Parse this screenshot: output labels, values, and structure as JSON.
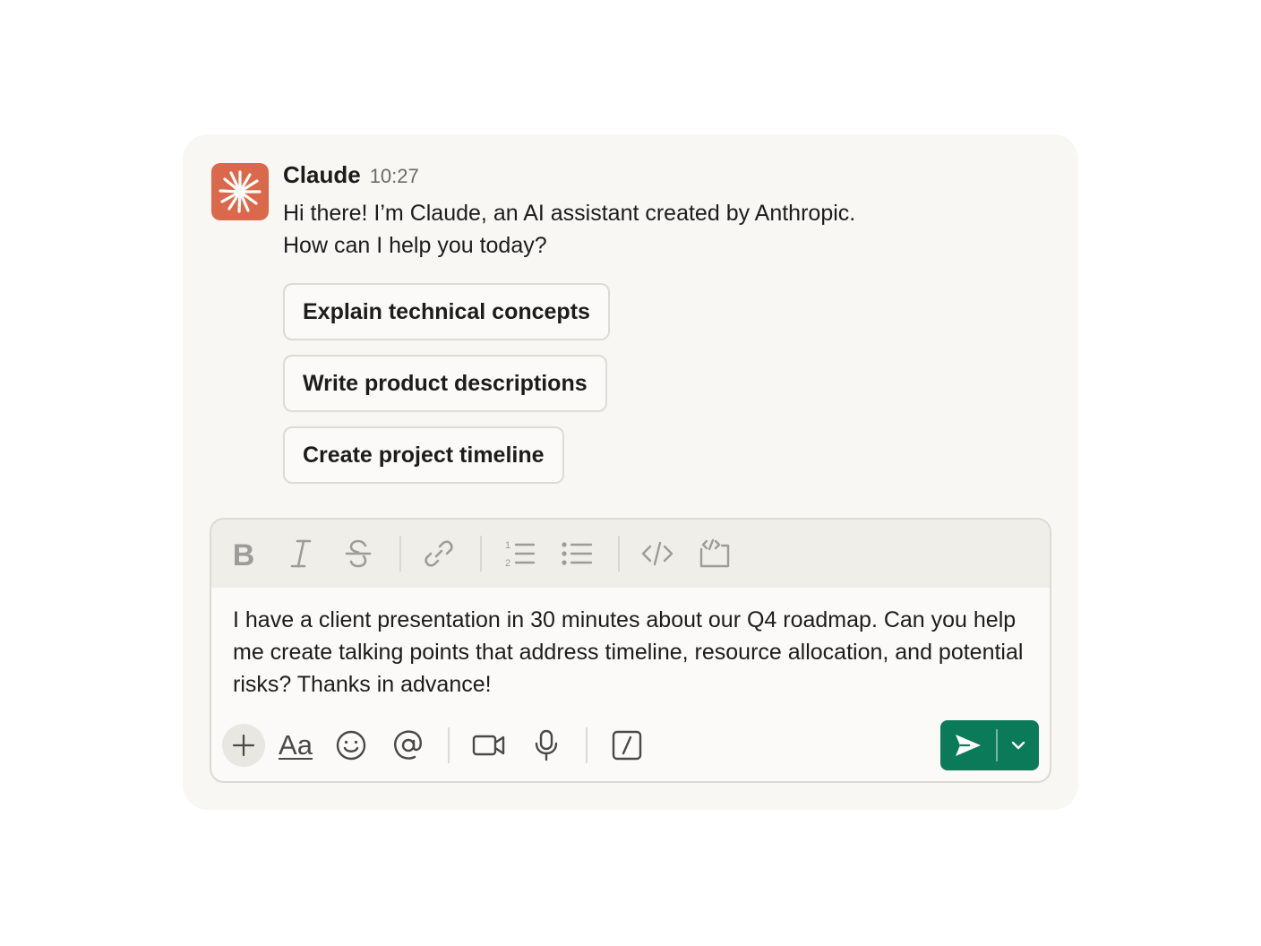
{
  "message": {
    "sender": "Claude",
    "time": "10:27",
    "lines": [
      "Hi there! I’m Claude, an AI assistant created by Anthropic.",
      "How can I help you today?"
    ],
    "avatar_icon": "claude-starburst-icon",
    "avatar_color": "#d9694a"
  },
  "suggestions": [
    "Explain technical concepts",
    "Write product descriptions",
    "Create project timeline"
  ],
  "composer": {
    "text": "I have a client presentation in 30 minutes about our Q4 roadmap. Can you help me create talking points that address timeline, resource allocation, and potential risks? Thanks in advance!",
    "format_toolbar": [
      "bold-icon",
      "italic-icon",
      "strikethrough-icon",
      "link-icon",
      "ordered-list-icon",
      "bulleted-list-icon",
      "code-icon",
      "code-block-icon"
    ],
    "actions": [
      "plus-icon",
      "text-format-icon",
      "emoji-icon",
      "mention-icon",
      "video-icon",
      "microphone-icon",
      "slash-command-icon"
    ],
    "send_icon": "send-icon",
    "send_menu_icon": "chevron-down-icon",
    "text_format_label": "Aa",
    "send_color": "#0b7a58"
  }
}
